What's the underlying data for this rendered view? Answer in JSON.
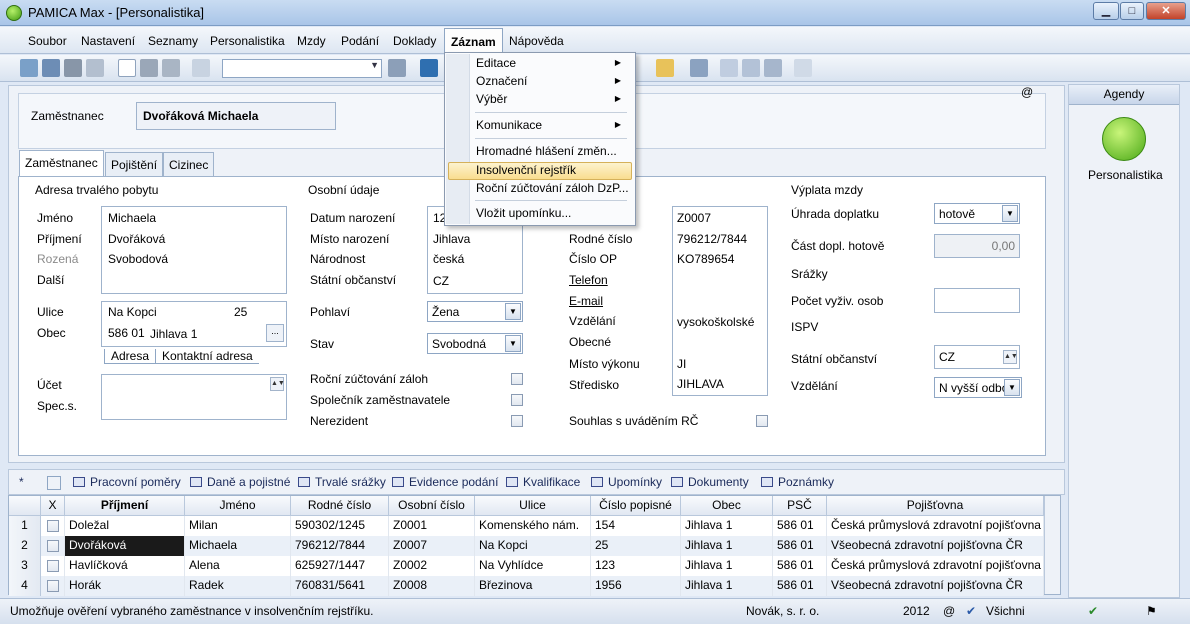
{
  "window": {
    "title": "PAMICA Max - [Personalistika]",
    "minimize": "▁",
    "maximize": "□",
    "close": "✕"
  },
  "menu": [
    "Soubor",
    "Nastavení",
    "Seznamy",
    "Personalistika",
    "Mzdy",
    "Podání",
    "Doklady",
    "Záznam",
    "Nápověda"
  ],
  "zaznam_menu": [
    "Editace",
    "Označení",
    "Výběr",
    "Komunikace",
    "Hromadné hlášení změn...",
    "Insolvenční rejstřík",
    "Roční zúčtování záloh DzP...",
    "Vložit upomínku..."
  ],
  "employee": {
    "label": "Zaměstnanec",
    "name": "Dvořáková Michaela",
    "at": "@"
  },
  "tabs": [
    "Zaměstnanec",
    "Pojištění",
    "Cizinec"
  ],
  "address": {
    "title": "Adresa trvalého pobytu",
    "labels": [
      "Jméno",
      "Příjmení",
      "Rozená",
      "Další",
      "Ulice",
      "Obec",
      "Účet",
      "Spec.s."
    ],
    "jmeno": "Michaela",
    "prijmeni": "Dvořáková",
    "rozena": "Svobodová",
    "ulice": "Na Kopci",
    "cislo": "25",
    "psc": "586 01",
    "obec": "Jihlava 1",
    "subtabs": [
      "Adresa",
      "Kontaktní adresa"
    ],
    "ellipsis": "..."
  },
  "personal": {
    "title": "Osobní údaje",
    "labels": [
      "Datum narození",
      "Místo narození",
      "Národnost",
      "Státní občanství",
      "Pohlaví",
      "Stav",
      "Roční zúčtování záloh",
      "Společník zaměstnavatele",
      "Nerezident"
    ],
    "datum": "12",
    "misto": "Jihlava",
    "narodnost": "česká",
    "obcanstvi": "CZ",
    "pohlavi": "Žena",
    "stav": "Svobodná"
  },
  "ids": {
    "labels": [
      "Rodné číslo",
      "Číslo OP",
      "Telefon",
      "E-mail",
      "Vzdělání",
      "Obecné",
      "Místo výkonu",
      "Středisko",
      "Souhlas s uváděním RČ"
    ],
    "osobni": "Z0007",
    "rodne": "796212/7844",
    "op": "KO789654",
    "vzdelani": "vysokoškolské",
    "misto_vykonu": "JI",
    "stredisko": "JIHLAVA"
  },
  "payout": {
    "title": "Výplata mzdy",
    "uhrada_label": "Úhrada doplatku",
    "uhrada": "hotově",
    "cast_label": "Část dopl. hotově",
    "cast": "0,00",
    "srazky": "Srážky",
    "vyziv_label": "Počet vyživ. osob",
    "ispv": "ISPV",
    "obc_label": "Státní občanství",
    "obc": "CZ",
    "vzd_label": "Vzdělání",
    "vzd": "N vyšší odbo"
  },
  "agenda": {
    "header": "Agendy",
    "item": "Personalistika"
  },
  "grid_tabs": [
    "Pracovní poměry",
    "Daně a pojistné",
    "Trvalé srážky",
    "Evidence podání",
    "Kvalifikace",
    "Upomínky",
    "Dokumenty",
    "Poznámky"
  ],
  "grid_tab_star": "*",
  "grid": {
    "headers": [
      "X",
      "Příjmení",
      "Jméno",
      "Rodné číslo",
      "Osobní číslo",
      "Ulice",
      "Číslo popisné",
      "Obec",
      "PSČ",
      "Pojišťovna"
    ],
    "rows": [
      {
        "n": "1",
        "prijmeni": "Doležal",
        "jmeno": "Milan",
        "rc": "590302/1245",
        "oc": "Z0001",
        "ulice": "Komenského nám.",
        "cp": "154",
        "obec": "Jihlava 1",
        "psc": "586 01",
        "poj": "Česká průmyslová zdravotní pojišťovna"
      },
      {
        "n": "2",
        "prijmeni": "Dvořáková",
        "jmeno": "Michaela",
        "rc": "796212/7844",
        "oc": "Z0007",
        "ulice": "Na Kopci",
        "cp": "25",
        "obec": "Jihlava 1",
        "psc": "586 01",
        "poj": "Všeobecná zdravotní pojišťovna ČR"
      },
      {
        "n": "3",
        "prijmeni": "Havlíčková",
        "jmeno": "Alena",
        "rc": "625927/1447",
        "oc": "Z0002",
        "ulice": "Na Vyhlídce",
        "cp": "123",
        "obec": "Jihlava 1",
        "psc": "586 01",
        "poj": "Česká průmyslová zdravotní pojišťovna"
      },
      {
        "n": "4",
        "prijmeni": "Horák",
        "jmeno": "Radek",
        "rc": "760831/5641",
        "oc": "Z0008",
        "ulice": "Březinova",
        "cp": "1956",
        "obec": "Jihlava 1",
        "psc": "586 01",
        "poj": "Všeobecná zdravotní pojišťovna ČR"
      }
    ]
  },
  "status": {
    "hint": "Umožňuje ověření vybraného zaměstnance v insolvenčním rejstříku.",
    "firm": "Novák, s. r. o.",
    "year": "2012",
    "at": "@",
    "filter": "Všichni"
  },
  "colors": {
    "accent": "#2a5aa8",
    "highlight": "#f9dd8f",
    "selected_row": "#1a1a1a"
  }
}
